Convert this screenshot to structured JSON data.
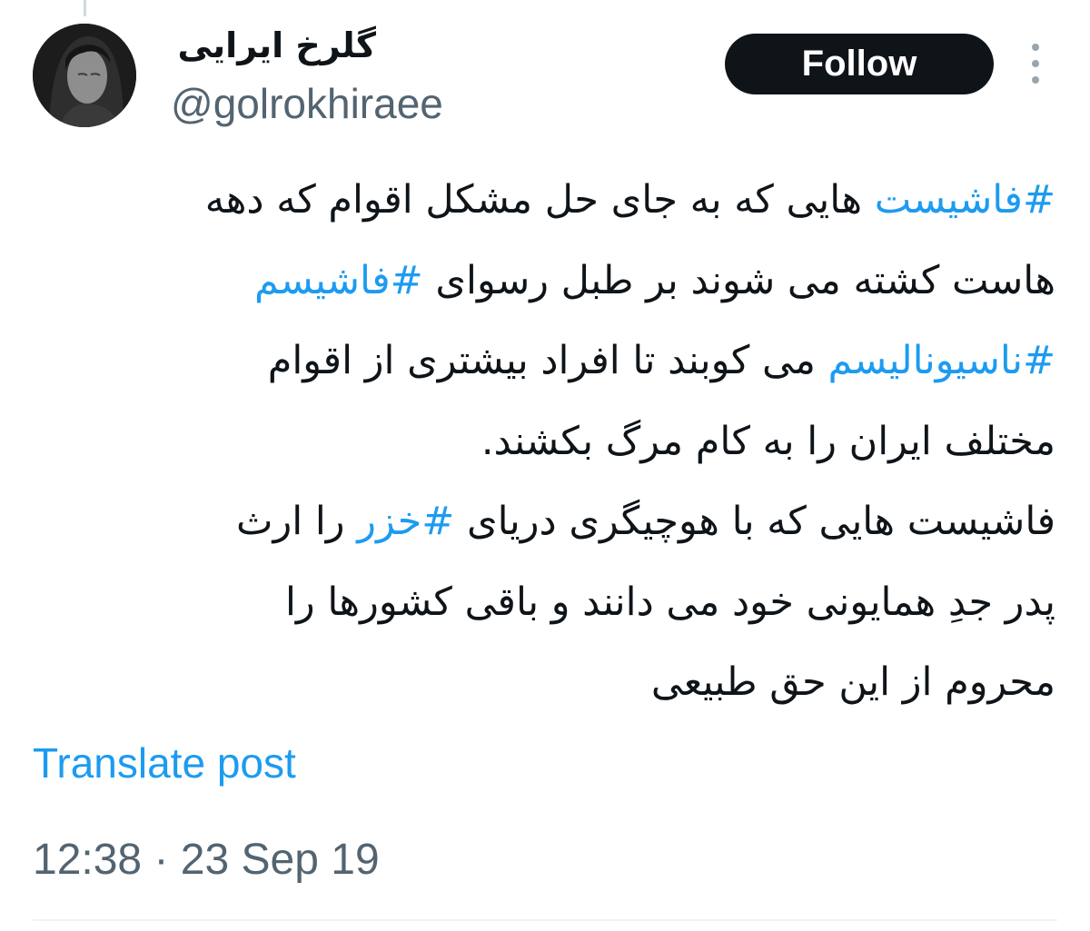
{
  "author": {
    "display_name": "گلرخ ایرایی",
    "handle": "@golrokhiraee"
  },
  "actions": {
    "follow_label": "Follow",
    "more_icon": "more-vertical-icon"
  },
  "tweet": {
    "lines": [
      [
        {
          "text": "#فاشیست",
          "hashtag": true
        },
        {
          "text": " هایی که به جای حل مشکل اقوام که دهه",
          "hashtag": false
        }
      ],
      [
        {
          "text": "هاست کشته می شوند بر طبل رسوای ",
          "hashtag": false
        },
        {
          "text": "#فاشیسم",
          "hashtag": true
        }
      ],
      [
        {
          "text": "#ناسیونالیسم",
          "hashtag": true
        },
        {
          "text": " می کوبند تا افراد بیشتری از اقوام",
          "hashtag": false
        }
      ],
      [
        {
          "text": "مختلف ایران را به کام مرگ بکشند.",
          "hashtag": false
        }
      ],
      [
        {
          "text": "فاشیست هایی که با هوچیگری دریای ",
          "hashtag": false
        },
        {
          "text": "#خزر",
          "hashtag": true
        },
        {
          "text": " را ارث",
          "hashtag": false
        }
      ],
      [
        {
          "text": "پدر جدِ همایونی خود می دانند و باقی کشورها را",
          "hashtag": false
        }
      ],
      [
        {
          "text": "محروم از این حق طبیعی",
          "hashtag": false
        }
      ]
    ]
  },
  "translate_label": "Translate post",
  "timestamp": "12:38 · 23 Sep 19",
  "colors": {
    "link": "#1d9bf0",
    "text": "#0f1419",
    "secondary": "#536471",
    "button_bg": "#0f1419"
  }
}
